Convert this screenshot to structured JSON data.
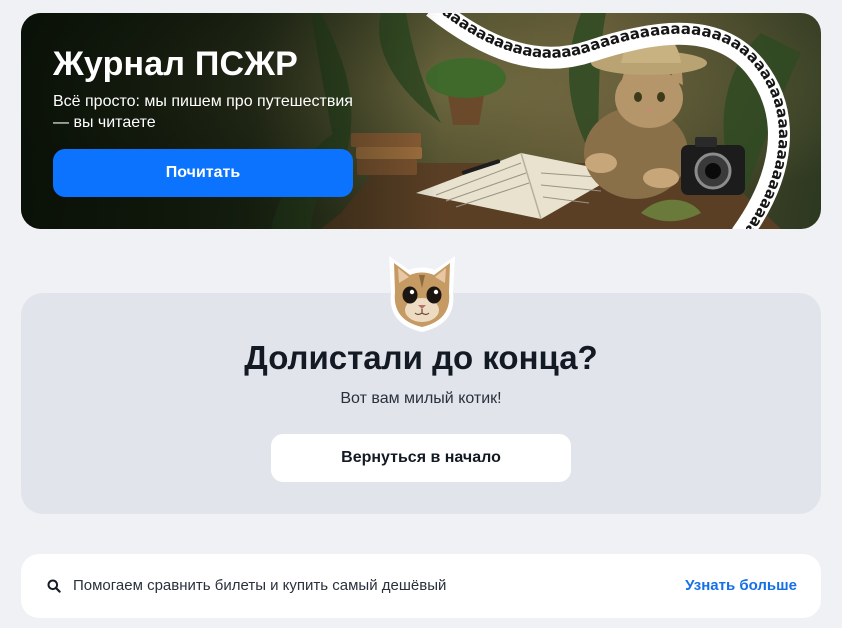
{
  "banner": {
    "title": "Журнал ПСЖР",
    "subtitle": "Всё просто: мы пишем про путешествия — вы читаете",
    "button_label": "Почитать",
    "ribbon_text": "аааааааааааааааааааааааааааааааааааааааааааааааааааааааааааааааааа"
  },
  "end_section": {
    "title": "Долистали до конца?",
    "subtitle": "Вот вам милый котик!",
    "button_label": "Вернуться в начало"
  },
  "info_strip": {
    "text": "Помогаем сравнить билеты и купить самый дешёвый",
    "link_label": "Узнать больше"
  },
  "colors": {
    "primary_button": "#0c73fe",
    "link": "#1570e8",
    "page_background": "#eff1f5",
    "card_background": "#e1e4ea"
  },
  "icons": {
    "banner_image": "cat-explorer-illustration",
    "sticker": "cat-face-sticker",
    "info": "search-icon"
  }
}
